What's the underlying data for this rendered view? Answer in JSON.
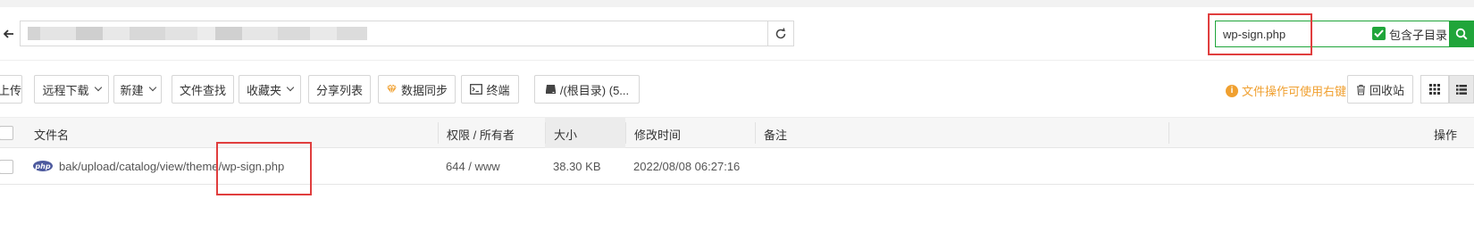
{
  "search": {
    "value": "wp-sign.php",
    "include_subdir_label": "包含子目录"
  },
  "toolbar": {
    "upload": "上传",
    "remote_download": "远程下载",
    "new": "新建",
    "file_search": "文件查找",
    "favorites": "收藏夹",
    "share_list": "分享列表",
    "data_sync": "数据同步",
    "terminal": "终端",
    "disk": "/(根目录) (5...",
    "tip": "文件操作可使用右键",
    "recycle_bin": "回收站"
  },
  "table": {
    "columns": {
      "name": "文件名",
      "perm_owner": "权限 / 所有者",
      "size": "大小",
      "mtime": "修改时间",
      "remark": "备注",
      "ops": "操作"
    },
    "rows": [
      {
        "icon_text": "php",
        "name": "bak/upload/catalog/view/theme/wp-sign.php",
        "perm_owner": "644 / www",
        "size": "38.30 KB",
        "mtime": "2022/08/08 06:27:16",
        "remark": ""
      }
    ]
  },
  "colors": {
    "accent": "#20a53a",
    "highlight": "#e03e3e",
    "tip": "#f0a030"
  }
}
